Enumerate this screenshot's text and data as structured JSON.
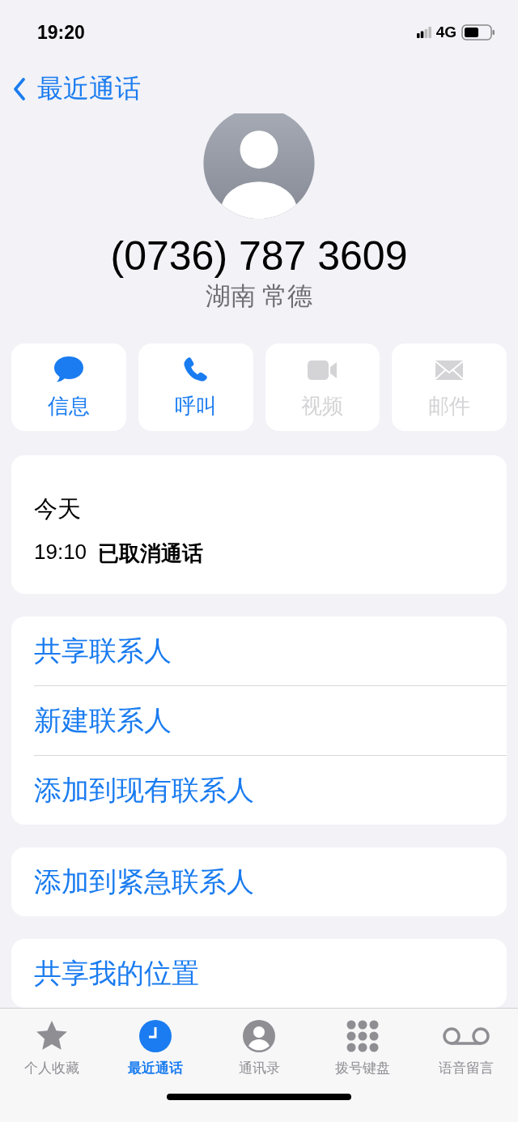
{
  "status_bar": {
    "time": "19:20",
    "network": "4G"
  },
  "nav": {
    "back_label": "最近通话"
  },
  "contact": {
    "number": "(0736) 787 3609",
    "location": "湖南 常德"
  },
  "actions": [
    {
      "kind": "message",
      "label": "信息",
      "disabled": false
    },
    {
      "kind": "call",
      "label": "呼叫",
      "disabled": false
    },
    {
      "kind": "video",
      "label": "视频",
      "disabled": true
    },
    {
      "kind": "mail",
      "label": "邮件",
      "disabled": true
    }
  ],
  "call_log": {
    "day": "今天",
    "entries": [
      {
        "time": "19:10",
        "status": "已取消通话"
      }
    ]
  },
  "option_groups": [
    {
      "items": [
        "共享联系人",
        "新建联系人",
        "添加到现有联系人"
      ]
    },
    {
      "items": [
        "添加到紧急联系人"
      ]
    },
    {
      "items": [
        "共享我的位置"
      ]
    }
  ],
  "tab_bar": [
    {
      "kind": "favorites",
      "label": "个人收藏",
      "selected": false
    },
    {
      "kind": "recents",
      "label": "最近通话",
      "selected": true
    },
    {
      "kind": "contacts",
      "label": "通讯录",
      "selected": false
    },
    {
      "kind": "keypad",
      "label": "拨号键盘",
      "selected": false
    },
    {
      "kind": "voicemail",
      "label": "语音留言",
      "selected": false
    }
  ]
}
